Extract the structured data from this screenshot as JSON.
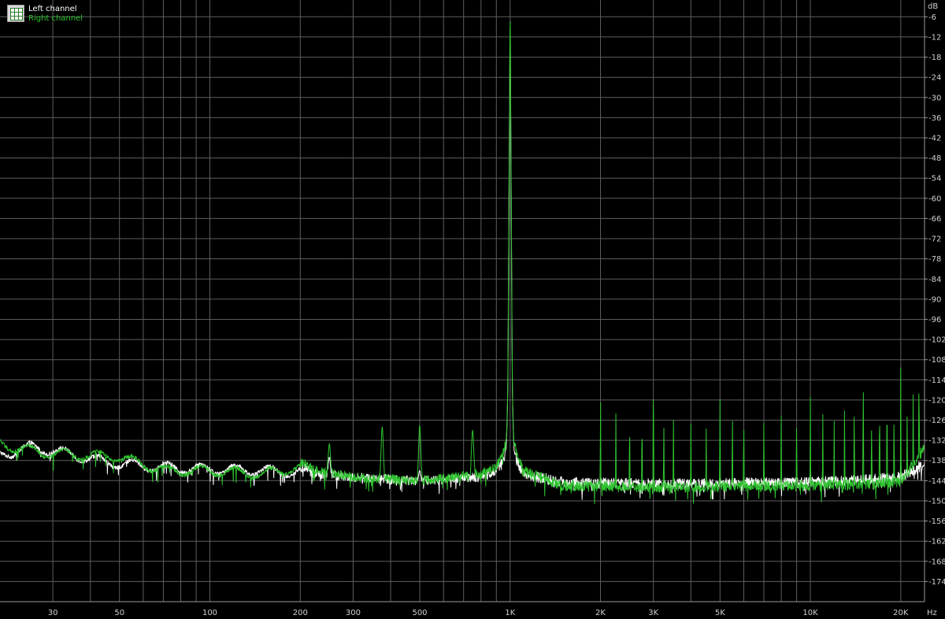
{
  "chart_data": {
    "type": "line",
    "xscale": "log",
    "xlim": [
      20,
      24000
    ],
    "ylim": [
      -180,
      -1
    ],
    "grid": true,
    "xlabel_unit": "Hz",
    "ylabel_unit": "dB",
    "x_tick_values": [
      30,
      50,
      100,
      200,
      300,
      500,
      1000,
      2000,
      3000,
      5000,
      10000,
      20000
    ],
    "x_tick_labels": [
      "30",
      "50",
      "100",
      "200",
      "300",
      "500",
      "1K",
      "2K",
      "3K",
      "5K",
      "10K",
      "20K"
    ],
    "y_tick_values": [
      -6,
      -12,
      -18,
      -24,
      -30,
      -36,
      -42,
      -48,
      -54,
      -60,
      -66,
      -72,
      -78,
      -84,
      -90,
      -96,
      -102,
      -108,
      -114,
      -120,
      -126,
      -132,
      -138,
      -144,
      -150,
      -156,
      -162,
      -168,
      -174
    ],
    "y_tick_labels": [
      "-6",
      "-12",
      "-18",
      "-24",
      "-30",
      "-36",
      "-42",
      "-48",
      "-54",
      "-60",
      "-66",
      "-72",
      "-78",
      "-84",
      "-90",
      "-96",
      "-102",
      "-108",
      "-114",
      "-120",
      "-126",
      "-132",
      "-138",
      "-144",
      "-150",
      "-156",
      "-162",
      "-168",
      "-174"
    ],
    "legend_placement": "top-left",
    "series": [
      {
        "name": "Left channel",
        "color": "#ffffff",
        "noise_floor": [
          [
            20,
            -136.5
          ],
          [
            25,
            -134
          ],
          [
            30,
            -135
          ],
          [
            40,
            -137.5
          ],
          [
            50,
            -139
          ],
          [
            70,
            -140
          ],
          [
            100,
            -140.5
          ],
          [
            150,
            -141
          ],
          [
            200,
            -141.5
          ],
          [
            300,
            -143
          ],
          [
            500,
            -144
          ],
          [
            800,
            -143
          ],
          [
            900,
            -141
          ],
          [
            980,
            -135
          ],
          [
            1000,
            -5
          ],
          [
            1020,
            -135
          ],
          [
            1100,
            -142
          ],
          [
            1500,
            -144.5
          ],
          [
            3000,
            -145
          ],
          [
            10000,
            -144.5
          ],
          [
            20000,
            -143
          ],
          [
            24000,
            -139
          ]
        ],
        "peaks": [
          [
            250,
            -137
          ],
          [
            500,
            -141
          ],
          [
            2000,
            -143
          ],
          [
            3000,
            -143
          ],
          [
            5000,
            -143
          ],
          [
            10000,
            -141
          ],
          [
            20000,
            -138
          ]
        ]
      },
      {
        "name": "Right channel",
        "color": "#2fc42f",
        "noise_floor": [
          [
            20,
            -133
          ],
          [
            25,
            -135
          ],
          [
            30,
            -136
          ],
          [
            40,
            -136.5
          ],
          [
            50,
            -137
          ],
          [
            60,
            -139
          ],
          [
            70,
            -141
          ],
          [
            100,
            -141
          ],
          [
            150,
            -142
          ],
          [
            200,
            -140
          ],
          [
            300,
            -143
          ],
          [
            500,
            -144
          ],
          [
            800,
            -142
          ],
          [
            900,
            -140
          ],
          [
            980,
            -132
          ],
          [
            1000,
            -2.5
          ],
          [
            1020,
            -132
          ],
          [
            1100,
            -141
          ],
          [
            1500,
            -145.5
          ],
          [
            3000,
            -146
          ],
          [
            10000,
            -145.5
          ],
          [
            20000,
            -144.5
          ],
          [
            24000,
            -134
          ]
        ],
        "peaks": [
          [
            250,
            -133
          ],
          [
            375,
            -128
          ],
          [
            500,
            -127.5
          ],
          [
            750,
            -129
          ],
          [
            2000,
            -118
          ],
          [
            2250,
            -124
          ],
          [
            2500,
            -125
          ],
          [
            2750,
            -124
          ],
          [
            3000,
            -108
          ],
          [
            3250,
            -127
          ],
          [
            3500,
            -126
          ],
          [
            4000,
            -127
          ],
          [
            4500,
            -128
          ],
          [
            5000,
            -117
          ],
          [
            5500,
            -123
          ],
          [
            6000,
            -124
          ],
          [
            7000,
            -126
          ],
          [
            8000,
            -124
          ],
          [
            9000,
            -125
          ],
          [
            10000,
            -119
          ],
          [
            11000,
            -124
          ],
          [
            12000,
            -125
          ],
          [
            13000,
            -122
          ],
          [
            14000,
            -120
          ],
          [
            15000,
            -110
          ],
          [
            16000,
            -126
          ],
          [
            17000,
            -119
          ],
          [
            18000,
            -116
          ],
          [
            19000,
            -123
          ],
          [
            20000,
            -109
          ],
          [
            21000,
            -125
          ],
          [
            22000,
            -118
          ],
          [
            23000,
            -112
          ]
        ]
      }
    ]
  }
}
